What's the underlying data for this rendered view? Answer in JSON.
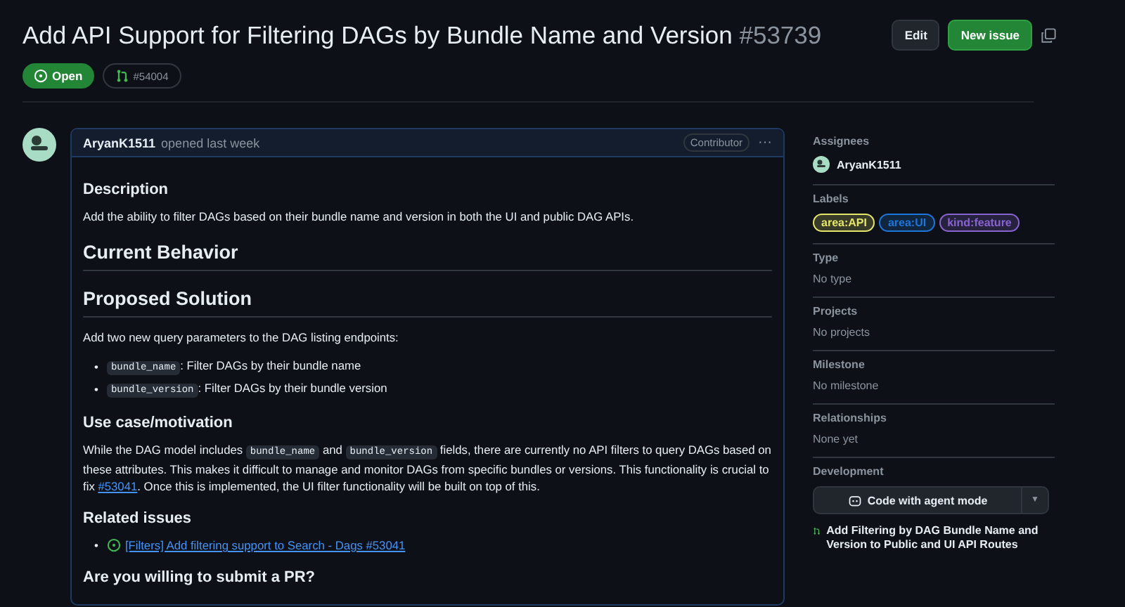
{
  "issue": {
    "title": "Add API Support for Filtering DAGs by Bundle Name and Version",
    "number": "#53739"
  },
  "actions": [
    {
      "label": "Edit",
      "kind": "plain"
    },
    {
      "label": "New issue",
      "kind": "primary"
    }
  ],
  "status": {
    "label": "Open"
  },
  "linked_pr": "#54004",
  "comment": {
    "author": "AryanK1511",
    "meta": "opened last week",
    "role": "Contributor",
    "menu": "···",
    "body": [
      {
        "kind": "h3",
        "text": "Description"
      },
      {
        "kind": "p",
        "segments": [
          {
            "kind": "text",
            "text": "Add the ability to filter DAGs based on their bundle name and version in both the UI and public DAG APIs."
          }
        ]
      },
      {
        "kind": "h2",
        "text": "Current Behavior"
      },
      {
        "kind": "h2",
        "text": "Proposed Solution"
      },
      {
        "kind": "p",
        "segments": [
          {
            "kind": "text",
            "text": "Add two new query parameters to the DAG listing endpoints:"
          }
        ]
      },
      {
        "kind": "ul",
        "marker": "•",
        "items": [
          {
            "segments": [
              {
                "kind": "code",
                "text": "bundle_name"
              },
              {
                "kind": "text",
                "text": ": Filter DAGs by their bundle name"
              }
            ]
          },
          {
            "segments": [
              {
                "kind": "code",
                "text": "bundle_version"
              },
              {
                "kind": "text",
                "text": ": Filter DAGs by their bundle version"
              }
            ]
          }
        ]
      },
      {
        "kind": "h3",
        "text": "Use case/motivation"
      },
      {
        "kind": "p",
        "segments": [
          {
            "kind": "text",
            "text": "While the DAG model includes "
          },
          {
            "kind": "code",
            "text": "bundle_name"
          },
          {
            "kind": "text",
            "text": " and "
          },
          {
            "kind": "code",
            "text": "bundle_version"
          },
          {
            "kind": "text",
            "text": " fields, there are currently no API filters to query DAGs based on these attributes. This makes it difficult to manage and monitor DAGs from specific bundles or versions. This functionality is crucial to fix "
          },
          {
            "kind": "link",
            "text": "#53041"
          },
          {
            "kind": "text",
            "text": ". Once this is implemented, the UI filter functionality will be built on top of this."
          }
        ]
      },
      {
        "kind": "h3",
        "text": "Related issues"
      },
      {
        "kind": "ul",
        "marker": "•",
        "items": [
          {
            "segments": [
              {
                "kind": "issue",
                "text": "[Filters] Add filtering support to Search - Dags #53041"
              }
            ]
          }
        ]
      },
      {
        "kind": "h3",
        "text": "Are you willing to submit a PR?"
      }
    ]
  },
  "sidebar": [
    {
      "kind": "assignee",
      "heading": "Assignees",
      "value": "AryanK1511"
    },
    {
      "kind": "labels",
      "heading": "Labels",
      "labels": [
        {
          "text": "area:API",
          "color": "#e4e669"
        },
        {
          "text": "area:UI",
          "color": "#1d76db"
        },
        {
          "text": "kind:feature",
          "color": "#8a63d2"
        }
      ]
    },
    {
      "kind": "text",
      "heading": "Type",
      "value": "No type"
    },
    {
      "kind": "text",
      "heading": "Projects",
      "value": "No projects"
    },
    {
      "kind": "text",
      "heading": "Milestone",
      "value": "No milestone"
    },
    {
      "kind": "text",
      "heading": "Relationships",
      "value": "None yet"
    },
    {
      "kind": "development",
      "heading": "Development",
      "button": "Code with agent mode",
      "dropdown": "▼",
      "pr": "Add Filtering by DAG Bundle Name and Version to Public and UI API Routes"
    }
  ]
}
